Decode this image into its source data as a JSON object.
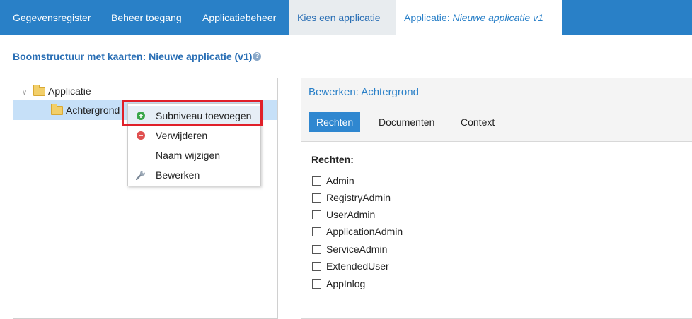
{
  "topnav": {
    "tabs": [
      {
        "label": "Gegevensregister"
      },
      {
        "label": "Beheer toegang"
      },
      {
        "label": "Applicatiebeheer"
      },
      {
        "label": "Kies een applicatie"
      },
      {
        "label_prefix": "Applicatie:",
        "label_value": "Nieuwe applicatie v1"
      }
    ]
  },
  "page": {
    "title": "Boomstructuur met kaarten: Nieuwe applicatie (v1)",
    "help_icon": "help-icon"
  },
  "tree": {
    "nodes": [
      {
        "label": "Applicatie",
        "expanded": true
      },
      {
        "label": "Achtergrond",
        "selected": true
      }
    ]
  },
  "context_menu": {
    "items": [
      {
        "label": "Subniveau toevoegen",
        "icon": "add-circle-icon"
      },
      {
        "label": "Verwijderen",
        "icon": "remove-circle-icon"
      },
      {
        "label": "Naam wijzigen",
        "icon": ""
      },
      {
        "label": "Bewerken",
        "icon": "wrench-icon"
      }
    ],
    "highlight_color": "#e0202a"
  },
  "edit": {
    "title": "Bewerken: Achtergrond",
    "tabs": [
      {
        "label": "Rechten",
        "active": true
      },
      {
        "label": "Documenten"
      },
      {
        "label": "Context"
      }
    ],
    "rights_heading": "Rechten:",
    "rights": [
      {
        "label": "Admin",
        "checked": false
      },
      {
        "label": "RegistryAdmin",
        "checked": false
      },
      {
        "label": "UserAdmin",
        "checked": false
      },
      {
        "label": "ApplicationAdmin",
        "checked": false
      },
      {
        "label": "ServiceAdmin",
        "checked": false
      },
      {
        "label": "ExtendedUser",
        "checked": false
      },
      {
        "label": "AppInlog",
        "checked": false
      }
    ]
  },
  "colors": {
    "nav_bg": "#2980c7",
    "accent": "#2a80c8",
    "selected_row": "#c6e0f8"
  }
}
